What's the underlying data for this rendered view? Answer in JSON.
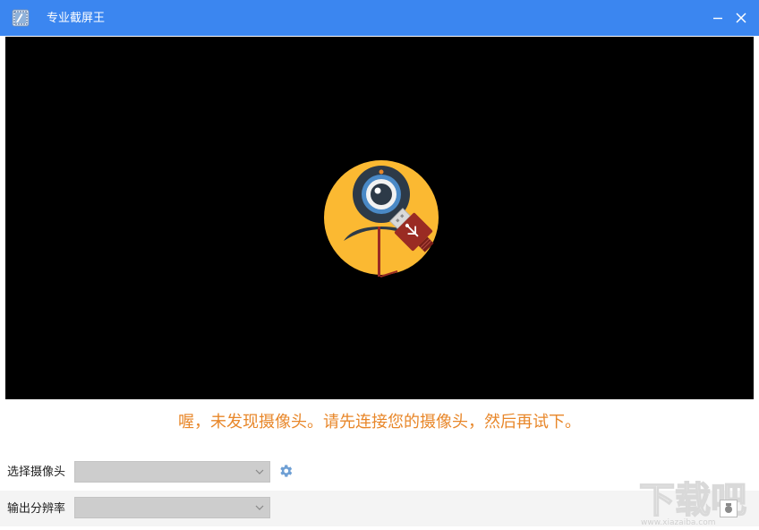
{
  "window": {
    "title": "专业截屏王",
    "title_bar_color": "#3b86f0",
    "icons": {
      "app": "app-logo-icon",
      "minimize": "minimize-icon",
      "close": "close-icon"
    }
  },
  "preview": {
    "background": "#000000",
    "illustration": "webcam-usb-disconnected-icon",
    "message": "喔，未发现摄像头。请先连接您的摄像头，然后再试下。",
    "message_color": "#e8872a"
  },
  "controls": {
    "camera_label": "选择摄像头",
    "camera_value": "",
    "camera_settings_icon": "gear-icon",
    "resolution_label": "输出分辨率",
    "resolution_value": ""
  },
  "watermark": {
    "text": "下载吧",
    "sub": "www.xiazaiba.com"
  }
}
